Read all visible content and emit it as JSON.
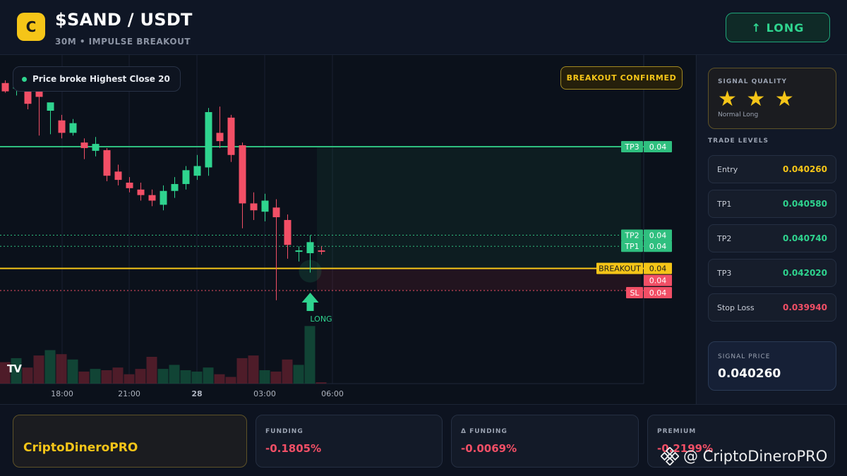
{
  "header": {
    "logo_letter": "C",
    "pair": "$SAND / USDT",
    "subtitle": "30M • IMPULSE BREAKOUT",
    "long_button": "↑ LONG"
  },
  "chart": {
    "status_pill": "Price broke Highest Close 20",
    "badge": "BREAKOUT CONFIRMED",
    "tv_logo": "TV",
    "long_marker_label": "LONG",
    "time_labels": [
      "18:00",
      "21:00",
      "28",
      "03:00",
      "06:00"
    ],
    "price_tags": [
      {
        "label": "TP3",
        "value": "0.04",
        "color": "#2fbf7f"
      },
      {
        "label": "TP2",
        "value": "0.04",
        "color": "#2fbf7f"
      },
      {
        "label": "TP1",
        "value": "0.04",
        "color": "#2fbf7f"
      },
      {
        "label": "BREAKOUT",
        "value": "0.04",
        "color": "#f5c518"
      },
      {
        "label": "",
        "value": "0.04",
        "color": "#f24f66"
      },
      {
        "label": "SL",
        "value": "0.04",
        "color": "#f24f66"
      }
    ],
    "colors": {
      "up": "#2fd48f",
      "down": "#f24f66",
      "breakout": "#f5c518",
      "tp": "#2fbf7f"
    }
  },
  "chart_data": {
    "type": "candlestick",
    "x": [
      "16:30",
      "17:00",
      "17:30",
      "18:00",
      "18:30",
      "19:00",
      "19:30",
      "20:00",
      "20:30",
      "21:00",
      "21:30",
      "22:00",
      "22:30",
      "23:00",
      "23:30",
      "00:00",
      "00:30",
      "01:00",
      "01:30",
      "02:00",
      "02:30",
      "03:00",
      "03:30",
      "04:00",
      "04:30",
      "05:00",
      "05:30",
      "06:00",
      "06:30"
    ],
    "series": [
      {
        "values_open": [
          0.04294,
          0.04286,
          0.04298,
          0.04285,
          0.04254,
          0.0424,
          0.04222,
          0.04208,
          0.04196,
          0.04197,
          0.04166,
          0.0415,
          0.0414,
          0.04132,
          0.04118,
          0.04138,
          0.04148,
          0.0416,
          0.04172,
          0.04222,
          0.04244,
          0.04204,
          0.0412,
          0.04108,
          0.04114,
          0.04096,
          0.04052,
          0.04048,
          0.04052
        ],
        "values_close": [
          0.04282,
          0.043,
          0.04264,
          0.04274,
          0.04266,
          0.04222,
          0.04236,
          0.042,
          0.04206,
          0.0416,
          0.04154,
          0.04142,
          0.04132,
          0.04124,
          0.04138,
          0.04148,
          0.04168,
          0.04174,
          0.04252,
          0.0421,
          0.0419,
          0.0412,
          0.0411,
          0.04124,
          0.041,
          0.0406,
          0.04052,
          0.04064,
          0.0405
        ],
        "values_high": [
          0.04298,
          0.0431,
          0.04302,
          0.04292,
          0.04262,
          0.04248,
          0.04242,
          0.04214,
          0.04216,
          0.042,
          0.04176,
          0.04158,
          0.0415,
          0.0414,
          0.04146,
          0.04158,
          0.04174,
          0.0419,
          0.04258,
          0.0426,
          0.04248,
          0.04208,
          0.04136,
          0.04134,
          0.04126,
          0.04104,
          0.04058,
          0.04074,
          0.04058
        ],
        "values_low": [
          0.0428,
          0.04276,
          0.04256,
          0.04218,
          0.0422,
          0.04214,
          0.04218,
          0.04184,
          0.04188,
          0.04152,
          0.04146,
          0.04136,
          0.04124,
          0.04116,
          0.0411,
          0.04128,
          0.0414,
          0.04154,
          0.0416,
          0.042,
          0.0418,
          0.04084,
          0.04096,
          0.04094,
          0.0398,
          0.0404,
          0.04036,
          0.0402,
          0.04046
        ],
        "volume": [
          32,
          38,
          24,
          42,
          50,
          44,
          36,
          18,
          22,
          20,
          24,
          14,
          22,
          40,
          22,
          28,
          20,
          18,
          24,
          14,
          10,
          38,
          42,
          20,
          18,
          36,
          28,
          86,
          2
        ]
      }
    ],
    "levels": {
      "tp3": 0.04202,
      "tp2": 0.04074,
      "tp1": 0.04058,
      "breakout": 0.04026,
      "sl": 0.03994
    },
    "xlabel": "",
    "ylabel": ""
  },
  "sidebar": {
    "quality": {
      "title": "SIGNAL QUALITY",
      "stars": "★ ★ ★",
      "rating": 3,
      "sub": "Normal Long"
    },
    "levels_title": "TRADE LEVELS",
    "levels": [
      {
        "name": "Entry",
        "value": "0.040260",
        "color": "#f5c518"
      },
      {
        "name": "TP1",
        "value": "0.040580",
        "color": "#2fd48f"
      },
      {
        "name": "TP2",
        "value": "0.040740",
        "color": "#2fd48f"
      },
      {
        "name": "TP3",
        "value": "0.042020",
        "color": "#2fd48f"
      },
      {
        "name": "Stop Loss",
        "value": "0.039940",
        "color": "#f24f66"
      }
    ],
    "signal": {
      "title": "SIGNAL PRICE",
      "value": "0.040260"
    }
  },
  "footer": {
    "brand": "CriptoDineroPRO",
    "metrics": [
      {
        "title": "FUNDING",
        "value": "-0.1805%"
      },
      {
        "title": "Δ FUNDING",
        "value": "-0.0069%"
      },
      {
        "title": "PREMIUM",
        "value": "-0.2199%"
      }
    ],
    "watermark": "@ CriptoDineroPRO",
    "watermark_icon": "binance-icon"
  }
}
